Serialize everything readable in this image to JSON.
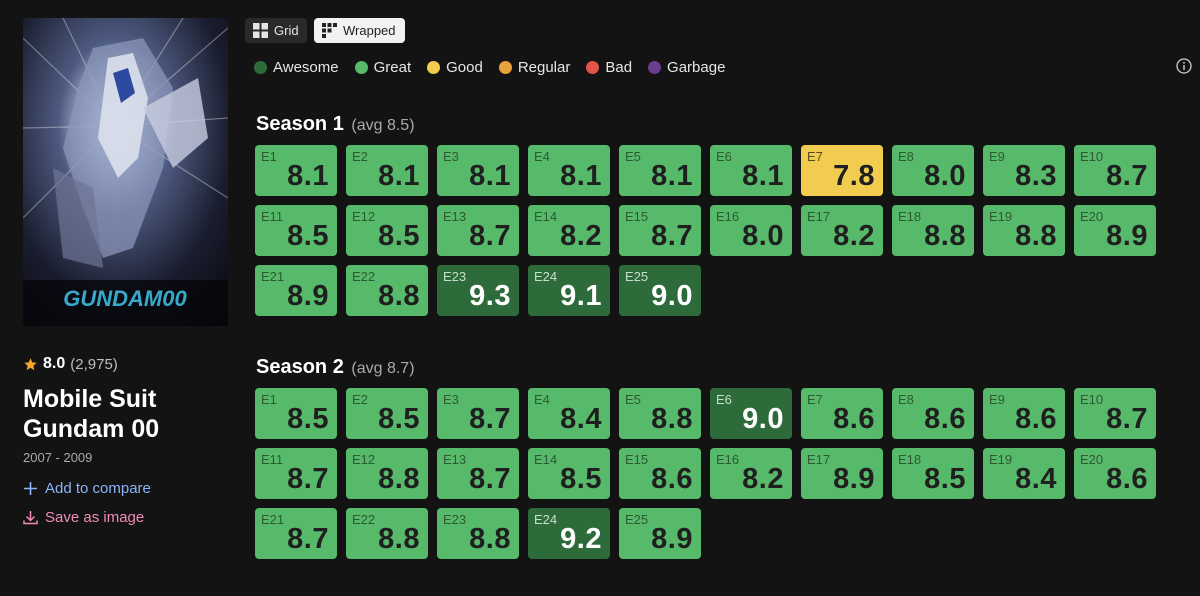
{
  "show": {
    "title": "Mobile Suit Gundam 00",
    "years": "2007 - 2009",
    "rating": "8.0",
    "votes": "(2,975)",
    "poster_logo": "GUNDAM00"
  },
  "actions": {
    "compare_label": "Add to compare",
    "save_label": "Save as image"
  },
  "view_toggles": {
    "grid_label": "Grid",
    "wrapped_label": "Wrapped",
    "selected": "Wrapped"
  },
  "colors": {
    "awesome": "#2e6b3b",
    "great": "#57b96a",
    "good": "#f2cc4f",
    "regular": "#e8a13c",
    "bad": "#e0554a",
    "garbage": "#6b3d8f"
  },
  "legend": [
    {
      "label": "Awesome",
      "color": "#2e6b3b"
    },
    {
      "label": "Great",
      "color": "#57b96a"
    },
    {
      "label": "Good",
      "color": "#f2cc4f"
    },
    {
      "label": "Regular",
      "color": "#e8a13c"
    },
    {
      "label": "Bad",
      "color": "#e0554a"
    },
    {
      "label": "Garbage",
      "color": "#6b3d8f"
    }
  ],
  "seasons": [
    {
      "title": "Season 1",
      "avg": "(avg 8.5)",
      "episodes": [
        {
          "label": "E1",
          "score": "8.1",
          "tier": "great"
        },
        {
          "label": "E2",
          "score": "8.1",
          "tier": "great"
        },
        {
          "label": "E3",
          "score": "8.1",
          "tier": "great"
        },
        {
          "label": "E4",
          "score": "8.1",
          "tier": "great"
        },
        {
          "label": "E5",
          "score": "8.1",
          "tier": "great"
        },
        {
          "label": "E6",
          "score": "8.1",
          "tier": "great"
        },
        {
          "label": "E7",
          "score": "7.8",
          "tier": "good"
        },
        {
          "label": "E8",
          "score": "8.0",
          "tier": "great"
        },
        {
          "label": "E9",
          "score": "8.3",
          "tier": "great"
        },
        {
          "label": "E10",
          "score": "8.7",
          "tier": "great"
        },
        {
          "label": "E11",
          "score": "8.5",
          "tier": "great"
        },
        {
          "label": "E12",
          "score": "8.5",
          "tier": "great"
        },
        {
          "label": "E13",
          "score": "8.7",
          "tier": "great"
        },
        {
          "label": "E14",
          "score": "8.2",
          "tier": "great"
        },
        {
          "label": "E15",
          "score": "8.7",
          "tier": "great"
        },
        {
          "label": "E16",
          "score": "8.0",
          "tier": "great"
        },
        {
          "label": "E17",
          "score": "8.2",
          "tier": "great"
        },
        {
          "label": "E18",
          "score": "8.8",
          "tier": "great"
        },
        {
          "label": "E19",
          "score": "8.8",
          "tier": "great"
        },
        {
          "label": "E20",
          "score": "8.9",
          "tier": "great"
        },
        {
          "label": "E21",
          "score": "8.9",
          "tier": "great"
        },
        {
          "label": "E22",
          "score": "8.8",
          "tier": "great"
        },
        {
          "label": "E23",
          "score": "9.3",
          "tier": "awesome"
        },
        {
          "label": "E24",
          "score": "9.1",
          "tier": "awesome"
        },
        {
          "label": "E25",
          "score": "9.0",
          "tier": "awesome"
        }
      ]
    },
    {
      "title": "Season 2",
      "avg": "(avg 8.7)",
      "episodes": [
        {
          "label": "E1",
          "score": "8.5",
          "tier": "great"
        },
        {
          "label": "E2",
          "score": "8.5",
          "tier": "great"
        },
        {
          "label": "E3",
          "score": "8.7",
          "tier": "great"
        },
        {
          "label": "E4",
          "score": "8.4",
          "tier": "great"
        },
        {
          "label": "E5",
          "score": "8.8",
          "tier": "great"
        },
        {
          "label": "E6",
          "score": "9.0",
          "tier": "awesome"
        },
        {
          "label": "E7",
          "score": "8.6",
          "tier": "great"
        },
        {
          "label": "E8",
          "score": "8.6",
          "tier": "great"
        },
        {
          "label": "E9",
          "score": "8.6",
          "tier": "great"
        },
        {
          "label": "E10",
          "score": "8.7",
          "tier": "great"
        },
        {
          "label": "E11",
          "score": "8.7",
          "tier": "great"
        },
        {
          "label": "E12",
          "score": "8.8",
          "tier": "great"
        },
        {
          "label": "E13",
          "score": "8.7",
          "tier": "great"
        },
        {
          "label": "E14",
          "score": "8.5",
          "tier": "great"
        },
        {
          "label": "E15",
          "score": "8.6",
          "tier": "great"
        },
        {
          "label": "E16",
          "score": "8.2",
          "tier": "great"
        },
        {
          "label": "E17",
          "score": "8.9",
          "tier": "great"
        },
        {
          "label": "E18",
          "score": "8.5",
          "tier": "great"
        },
        {
          "label": "E19",
          "score": "8.4",
          "tier": "great"
        },
        {
          "label": "E20",
          "score": "8.6",
          "tier": "great"
        },
        {
          "label": "E21",
          "score": "8.7",
          "tier": "great"
        },
        {
          "label": "E22",
          "score": "8.8",
          "tier": "great"
        },
        {
          "label": "E23",
          "score": "8.8",
          "tier": "great"
        },
        {
          "label": "E24",
          "score": "9.2",
          "tier": "awesome"
        },
        {
          "label": "E25",
          "score": "8.9",
          "tier": "great"
        }
      ]
    }
  ]
}
